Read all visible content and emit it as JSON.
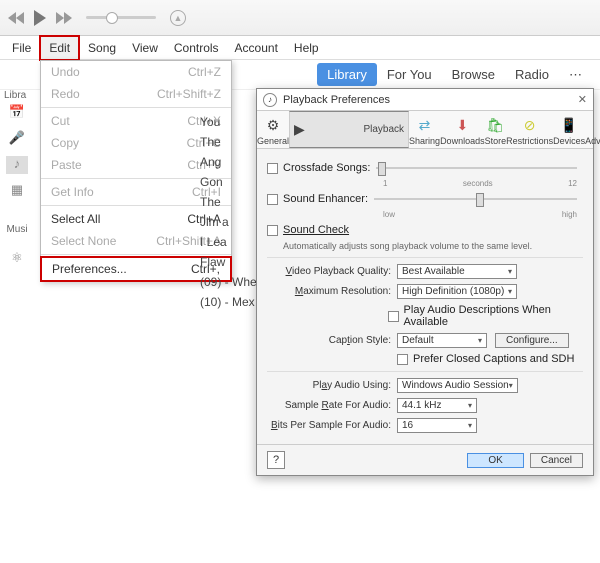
{
  "menubar": [
    "File",
    "Edit",
    "Song",
    "View",
    "Controls",
    "Account",
    "Help"
  ],
  "nav": {
    "library": "Library",
    "foryou": "For You",
    "browse": "Browse",
    "radio": "Radio"
  },
  "left": {
    "lib": "Libra",
    "music": "Musi"
  },
  "dropdown": {
    "undo": {
      "label": "Undo",
      "key": "Ctrl+Z"
    },
    "redo": {
      "label": "Redo",
      "key": "Ctrl+Shift+Z"
    },
    "cut": {
      "label": "Cut",
      "key": "Ctrl+X"
    },
    "copy": {
      "label": "Copy",
      "key": "Ctrl+C"
    },
    "paste": {
      "label": "Paste",
      "key": "Ctrl+V"
    },
    "getinfo": {
      "label": "Get Info",
      "key": "Ctrl+I"
    },
    "selall": {
      "label": "Select All",
      "key": "Ctrl+A"
    },
    "selnone": {
      "label": "Select None",
      "key": "Ctrl+Shift+A"
    },
    "prefs": {
      "label": "Preferences...",
      "key": "Ctrl+,"
    }
  },
  "songs": [
    "You",
    "The",
    "Ang",
    "Gon",
    "The",
    "Jim a",
    "I Lea",
    "Flaw",
    "(09) - Whe",
    "(10) - Mex"
  ],
  "dialog": {
    "title": "Playback Preferences",
    "tabs": [
      "General",
      "Playback",
      "Sharing",
      "Downloads",
      "Store",
      "Restrictions",
      "Devices",
      "Advanced"
    ],
    "crossfade": "Crossfade Songs:",
    "cf_lo": "1",
    "cf_mid": "seconds",
    "cf_hi": "12",
    "enhancer": "Sound Enhancer:",
    "en_lo": "low",
    "en_hi": "high",
    "soundcheck": "Sound Check",
    "soundcheck_note": "Automatically adjusts song playback volume to the same level.",
    "vpq_label": "Video Playback Quality:",
    "vpq_val": "Best Available",
    "maxres_label": "Maximum Resolution:",
    "maxres_val": "High Definition (1080p)",
    "playdesc": "Play Audio Descriptions When Available",
    "caption_label": "Caption Style:",
    "caption_val": "Default",
    "configure": "Configure...",
    "prefcc": "Prefer Closed Captions and SDH",
    "pau_label": "Play Audio Using:",
    "pau_val": "Windows Audio Session",
    "sr_label": "Sample Rate For Audio:",
    "sr_val": "44.1 kHz",
    "bps_label": "Bits Per Sample For Audio:",
    "bps_val": "16",
    "ok": "OK",
    "cancel": "Cancel",
    "help": "?"
  }
}
